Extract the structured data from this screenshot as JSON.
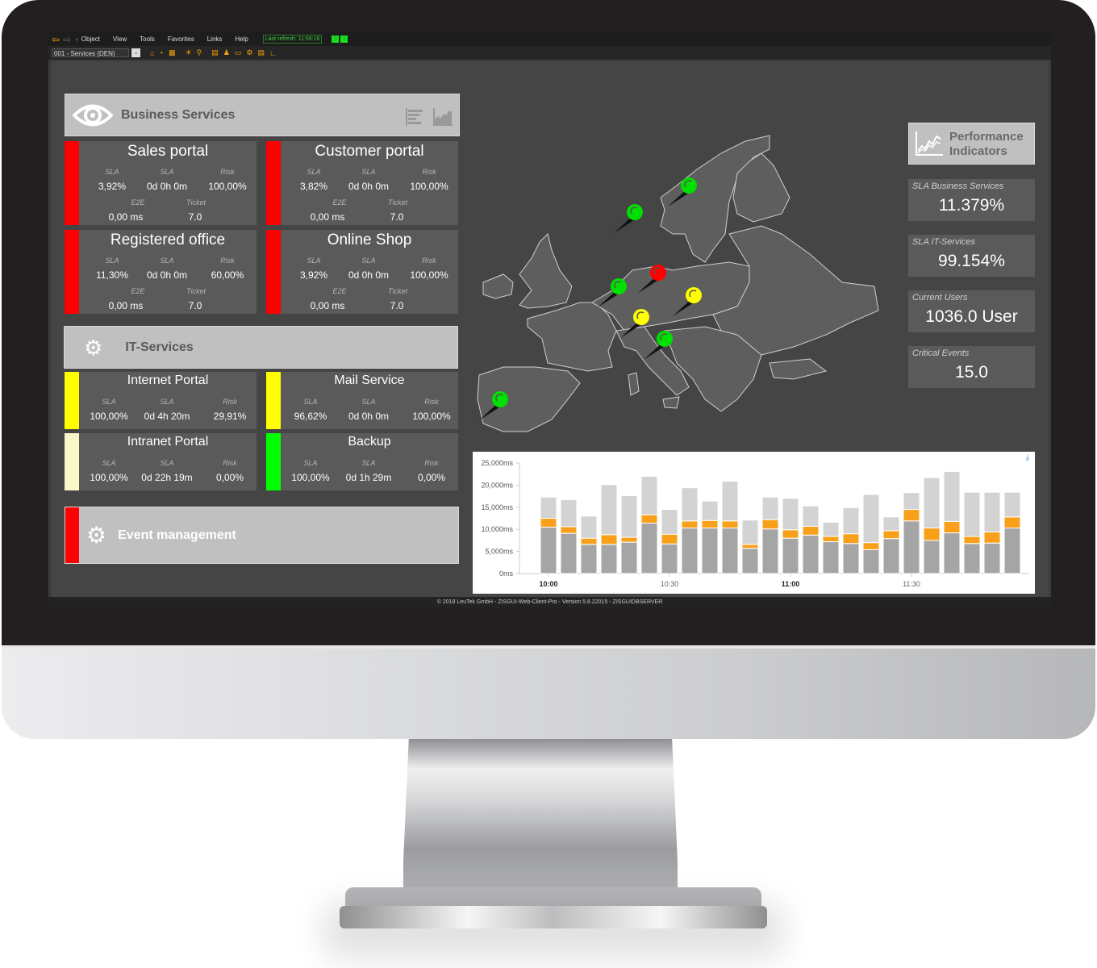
{
  "menu": {
    "items": [
      "Object",
      "View",
      "Tools",
      "Favorites",
      "Links",
      "Help"
    ],
    "last_refresh": "Last refresh: 11:56:16",
    "indicators": [
      "0",
      "1"
    ]
  },
  "toolbar": {
    "view_select": "001 - Services (DEN)",
    "icons": [
      "home-icon",
      "network-icon",
      "lock-icon",
      "sun-icon",
      "search-icon",
      "document-icon",
      "users-icon",
      "trash-icon",
      "gear-icon",
      "file-icon",
      "chart-icon"
    ]
  },
  "business_services": {
    "title": "Business Services",
    "tiles": [
      {
        "name": "Sales portal",
        "status_color": "#ff0000",
        "sla_label": "SLA",
        "sla": "3,92%",
        "sla_time_label": "SLA",
        "sla_time": "0d 0h 0m",
        "risk_label": "Risk",
        "risk": "100,00%",
        "e2e_label": "E2E",
        "e2e": "0,00  ms",
        "ticket_label": "Ticket",
        "ticket": "7.0"
      },
      {
        "name": "Customer portal",
        "status_color": "#ff0000",
        "sla_label": "SLA",
        "sla": "3,82%",
        "sla_time_label": "SLA",
        "sla_time": "0d 0h 0m",
        "risk_label": "Risk",
        "risk": "100,00%",
        "e2e_label": "E2E",
        "e2e": "0,00  ms",
        "ticket_label": "Ticket",
        "ticket": "7.0"
      },
      {
        "name": "Registered office",
        "status_color": "#ff0000",
        "sla_label": "SLA",
        "sla": "11,30%",
        "sla_time_label": "SLA",
        "sla_time": "0d 0h 0m",
        "risk_label": "Risk",
        "risk": "60,00%",
        "e2e_label": "E2E",
        "e2e": "0,00  ms",
        "ticket_label": "Ticket",
        "ticket": "7.0"
      },
      {
        "name": "Online Shop",
        "status_color": "#ff0000",
        "sla_label": "SLA",
        "sla": "3,92%",
        "sla_time_label": "SLA",
        "sla_time": "0d 0h 0m",
        "risk_label": "Risk",
        "risk": "100,00%",
        "e2e_label": "E2E",
        "e2e": "0,00  ms",
        "ticket_label": "Ticket",
        "ticket": "7.0"
      }
    ]
  },
  "it_services": {
    "title": "IT-Services",
    "tiles": [
      {
        "name": "Internet Portal",
        "status_color": "#ffff00",
        "sla_label": "SLA",
        "sla": "100,00%",
        "sla_time_label": "SLA",
        "sla_time": "0d 4h 20m",
        "risk_label": "Risk",
        "risk": "29,91%"
      },
      {
        "name": "Mail Service",
        "status_color": "#ffff00",
        "sla_label": "SLA",
        "sla": "96,62%",
        "sla_time_label": "SLA",
        "sla_time": "0d 0h 0m",
        "risk_label": "Risk",
        "risk": "100,00%"
      },
      {
        "name": "Intranet Portal",
        "status_color": "#f7f7c8",
        "sla_label": "SLA",
        "sla": "100,00%",
        "sla_time_label": "SLA",
        "sla_time": "0d 22h 19m",
        "risk_label": "Risk",
        "risk": "0,00%"
      },
      {
        "name": "Backup",
        "status_color": "#00ff00",
        "sla_label": "SLA",
        "sla": "100,00%",
        "sla_time_label": "SLA",
        "sla_time": "0d 1h 29m",
        "risk_label": "Risk",
        "risk": "0,00%"
      }
    ]
  },
  "event_management": {
    "title": "Event management",
    "status_color": "#ff0000"
  },
  "kpis": {
    "title_line1": "Performance",
    "title_line2": "Indicators",
    "items": [
      {
        "label": "SLA Business Services",
        "value": "11.379%"
      },
      {
        "label": "SLA IT-Services",
        "value": "99.154%"
      },
      {
        "label": "Current Users",
        "value": "1036.0 User"
      },
      {
        "label": "Critical Events",
        "value": "15.0"
      }
    ]
  },
  "map": {
    "pins": [
      {
        "location": "Sweden",
        "status": "green"
      },
      {
        "location": "Norway",
        "status": "green"
      },
      {
        "location": "Germany-North",
        "status": "red"
      },
      {
        "location": "Netherlands",
        "status": "green"
      },
      {
        "location": "Czech Republic",
        "status": "yellow"
      },
      {
        "location": "Germany-South",
        "status": "yellow"
      },
      {
        "location": "Austria",
        "status": "green"
      },
      {
        "location": "Portugal",
        "status": "green"
      }
    ],
    "status_colors": {
      "green": "#00e000",
      "red": "#ff0000",
      "yellow": "#ffff00"
    }
  },
  "footer": "© 2018 LeuTek GmbH - ZISGUI-Web-Client-Pro - Version 5.8.22015 - ZISGUIDBSERVER",
  "chart_data": {
    "type": "bar",
    "stacked": true,
    "title": "",
    "xlabel": "",
    "ylabel": "",
    "ylim": [
      0,
      25000
    ],
    "y_ticks": [
      "0ms",
      "5,000ms",
      "10,000ms",
      "15,000ms",
      "20,000ms",
      "25,000ms"
    ],
    "x_tick_labels": [
      {
        "label": "10:00",
        "index": 0,
        "bold": true
      },
      {
        "label": "10:30",
        "index": 6,
        "bold": false
      },
      {
        "label": "11:00",
        "index": 12,
        "bold": true
      },
      {
        "label": "11:30",
        "index": 18,
        "bold": false
      }
    ],
    "series": [
      {
        "name": "base",
        "color": "#a5a5a5",
        "values": [
          10500,
          9100,
          6600,
          6600,
          7100,
          11400,
          6700,
          10300,
          10300,
          10300,
          5700,
          10100,
          8000,
          8700,
          7200,
          6800,
          5400,
          7900,
          11900,
          7500,
          9200,
          6800,
          6900,
          10300
        ]
      },
      {
        "name": "middle",
        "color": "#f9a01b",
        "values": [
          2000,
          1500,
          1400,
          2200,
          1100,
          1900,
          2200,
          1600,
          1700,
          1600,
          900,
          2100,
          1900,
          2000,
          1200,
          2200,
          1600,
          1800,
          2600,
          2800,
          2600,
          1600,
          2500,
          2500
        ]
      },
      {
        "name": "top",
        "color": "#d3d3d3",
        "values": [
          4800,
          6100,
          5000,
          11300,
          9400,
          8700,
          5600,
          7500,
          4400,
          9000,
          5500,
          5100,
          7100,
          4600,
          3200,
          5900,
          10900,
          3100,
          3800,
          11400,
          11300,
          10000,
          9000,
          5600
        ]
      }
    ],
    "grid": false,
    "legend": "none"
  }
}
